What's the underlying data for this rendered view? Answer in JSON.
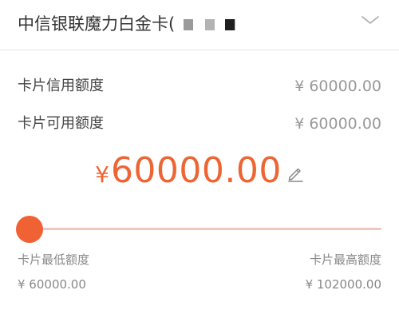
{
  "header": {
    "card_title": "中信银联魔力白金卡(",
    "chevron_icon": "chevron-down-icon"
  },
  "details": {
    "credit_limit_label": "卡片信用额度",
    "credit_limit_value": "¥ 60000.00",
    "available_limit_label": "卡片可用额度",
    "available_limit_value": "¥ 60000.00"
  },
  "amount": {
    "currency": "¥",
    "value": "60000.00",
    "edit_icon": "pencil-icon"
  },
  "slider": {
    "level": 0,
    "min_label": "卡片最低额度",
    "min_value": "¥ 60000.00",
    "max_label": "卡片最高额度",
    "max_value": "¥ 102000.00"
  },
  "colors": {
    "accent": "#ee6433",
    "track": "#f1c7bb",
    "muted_text": "#999999",
    "masked_blocks": [
      "#8c8c8c",
      "#b3b3b3",
      "#bfbfbf",
      "#222222"
    ]
  }
}
